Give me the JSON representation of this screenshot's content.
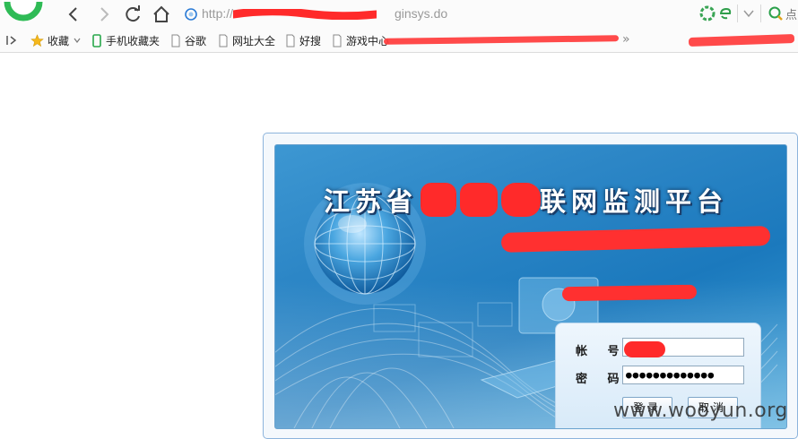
{
  "browser": {
    "address": {
      "prefix": "http://",
      "suffix": "ginsys.do"
    },
    "search_hint": "点",
    "bookmarks": [
      {
        "label": "收藏",
        "icon": "star-icon"
      },
      {
        "label": "手机收藏夹",
        "icon": "phone-icon"
      },
      {
        "label": "谷歌",
        "icon": "page-icon"
      },
      {
        "label": "网址大全",
        "icon": "page-icon"
      },
      {
        "label": "好搜",
        "icon": "page-icon"
      },
      {
        "label": "游戏中心",
        "icon": "page-icon"
      }
    ],
    "more": "»"
  },
  "login": {
    "title_start": "江苏省",
    "title_end": "联网监测平台",
    "account_label": "帐 号:",
    "password_label": "密 码:",
    "password_mask": "●●●●●●●●●●●●●",
    "login_button": "登录",
    "cancel_button": "取消"
  },
  "watermark": "www.wooyun.org",
  "colors": {
    "accent": "#2c86c6",
    "redaction": "#ff2a2a"
  }
}
